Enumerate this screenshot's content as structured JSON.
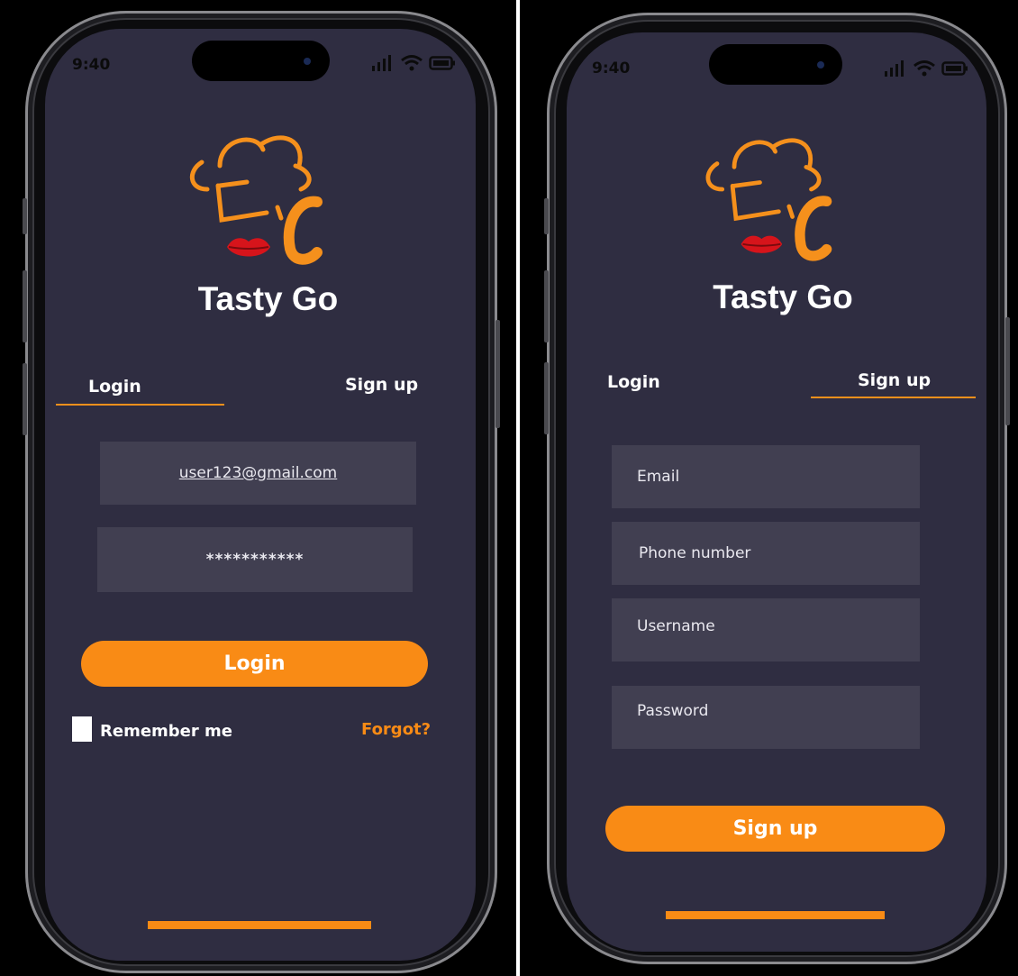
{
  "login_screen": {
    "status_time": "9:40",
    "app_title": "Tasty Go",
    "tabs": {
      "login": "Login",
      "signup": "Sign up",
      "active": "login"
    },
    "email_value": "user123@gmail.com",
    "password_value": "***********",
    "submit_label": "Login",
    "remember_label": "Remember me",
    "remember_checked": false,
    "forgot_label": "Forgot?"
  },
  "signup_screen": {
    "status_time": "9:40",
    "app_title": "Tasty Go",
    "tabs": {
      "login": "Login",
      "signup": "Sign up",
      "active": "signup"
    },
    "email_placeholder": "Email",
    "phone_placeholder": "Phone number",
    "username_placeholder": "Username",
    "password_placeholder": "Password",
    "submit_label": "Sign up"
  },
  "colors": {
    "screen_bg": "#2f2d41",
    "field_bg": "#413f51",
    "accent": "#f98b15",
    "lips": "#d6141b"
  },
  "icons": [
    "chef-hat-logo",
    "cellular-signal-icon",
    "wifi-icon",
    "battery-icon"
  ]
}
